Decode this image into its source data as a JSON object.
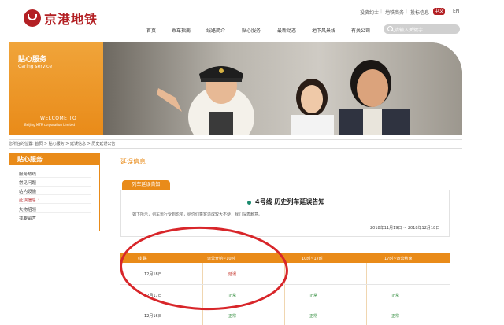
{
  "header": {
    "logo_text": "京港地铁",
    "top_links": [
      "投资约士",
      "地铁商务",
      "投标信息"
    ],
    "lang_cn": "中文",
    "lang_en": "EN",
    "nav": [
      "首页",
      "乘车指南",
      "线路简介",
      "贴心服务",
      "最新动态",
      "地下风景线",
      "有关公司"
    ],
    "search_placeholder": "请输入关键字"
  },
  "banner": {
    "title": "贴心服务",
    "subtitle": "Caring service",
    "welcome": "WELCOME TO",
    "corp": "Beijing MTR corporation Limited"
  },
  "breadcrumb": "您所在的位置: 首页 > 贴心服务 > 延误信息 > 历史延误公告",
  "sidebar": {
    "heading": "贴心服务",
    "items": [
      "服务热线",
      "常见问题",
      "站内设施",
      "延误信息",
      "失物招领",
      "我要留言"
    ],
    "active_index": 3
  },
  "main": {
    "title": "延误信息",
    "tab": "列车延误告知",
    "notice_title": "4号线 历史列车延误告知",
    "notice_body": "如下所示，列车运行受到影响，给你们乘客造成较大不便，我们深表歉意。",
    "notice_date": "2018年11月19日 ~ 2018年12月18日"
  },
  "table": {
    "headers": [
      "线 路",
      "运营开始~10时",
      "10时~17时",
      "17时~运营结束"
    ],
    "rows": [
      {
        "date": "12月18日",
        "cells": [
          "延误",
          "",
          ""
        ]
      },
      {
        "date": "12月17日",
        "cells": [
          "正常",
          "正常",
          "正常"
        ]
      },
      {
        "date": "12月16日",
        "cells": [
          "正常",
          "正常",
          "正常"
        ]
      }
    ]
  },
  "colors": {
    "brand_red": "#b32024",
    "accent_orange": "#e98b19",
    "annotation_red": "#d8262a"
  }
}
